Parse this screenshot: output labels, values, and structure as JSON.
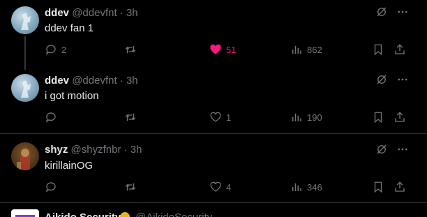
{
  "tweets": [
    {
      "name": "ddev",
      "handle": "@ddevfnt",
      "time": "· 3h",
      "text": "ddev fan 1",
      "replies": "2",
      "retweets": "",
      "likes": "51",
      "liked": true,
      "views": "862",
      "avatar_icon": "avatar-figure-blue"
    },
    {
      "name": "ddev",
      "handle": "@ddevfnt",
      "time": "· 3h",
      "text": "i got motion",
      "replies": "",
      "retweets": "",
      "likes": "1",
      "liked": false,
      "views": "190",
      "avatar_icon": "avatar-figure-blue"
    },
    {
      "name": "shyz",
      "handle": "@shyzfnbr",
      "time": "· 3h",
      "text": "kirillainOG",
      "replies": "",
      "retweets": "",
      "likes": "4",
      "liked": false,
      "views": "346",
      "avatar_icon": "avatar-crowd-brown"
    }
  ],
  "peek": {
    "name": "Aikido Security",
    "handle": "@AikidoSecurity"
  },
  "colors": {
    "background": "#000000",
    "text": "#e7e9ea",
    "muted": "#71767b",
    "like": "#f91880",
    "separator": "#2f3336"
  }
}
